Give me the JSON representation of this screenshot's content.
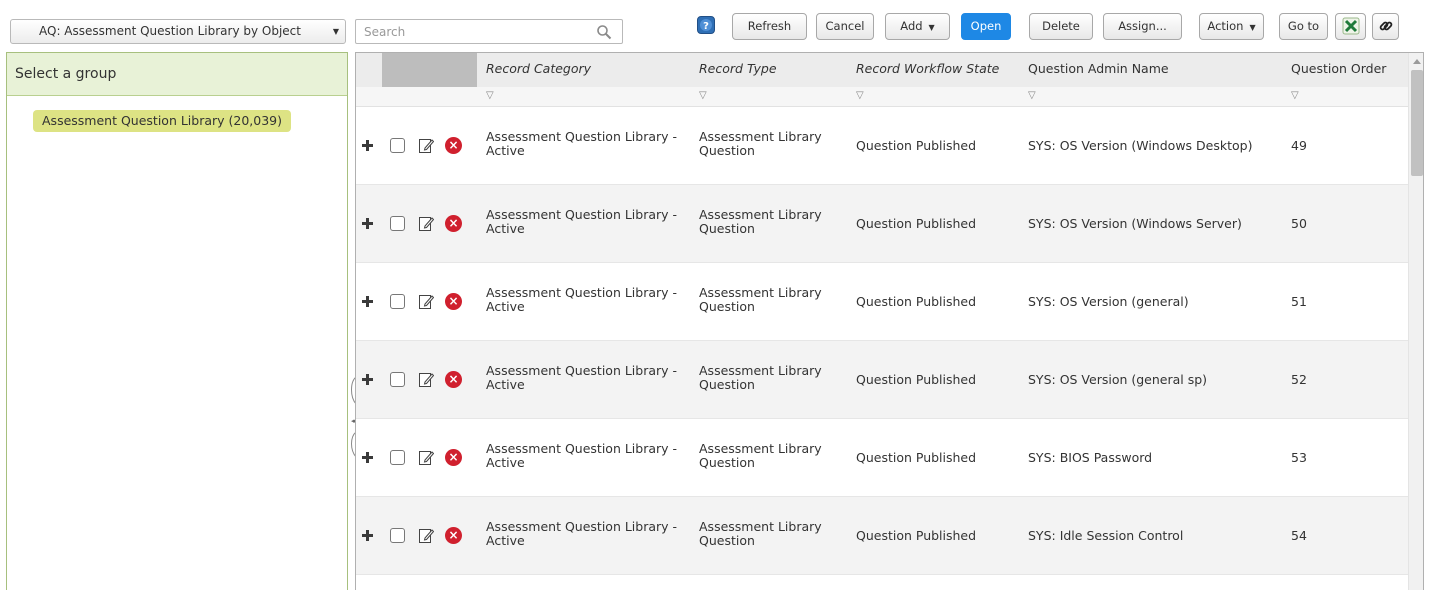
{
  "toolbar": {
    "view_select": "AQ: Assessment Question Library by Object",
    "search_placeholder": "Search",
    "refresh": "Refresh",
    "cancel": "Cancel",
    "add": "Add",
    "open": "Open",
    "delete": "Delete",
    "assign": "Assign...",
    "action": "Action",
    "goto": "Go to"
  },
  "left_panel": {
    "header": "Select a group",
    "group": "Assessment Question Library (20,039)"
  },
  "grid": {
    "columns": [
      "Record Category",
      "Record Type",
      "Record Workflow State",
      "Question Admin Name",
      "Question Order"
    ],
    "rows": [
      {
        "category_1": "Assessment Question Library -",
        "category_2": "Active",
        "type_1": "Assessment Library",
        "type_2": "Question",
        "state": "Question Published",
        "name": "SYS: OS Version (Windows Desktop)",
        "order": "49"
      },
      {
        "category_1": "Assessment Question Library -",
        "category_2": "Active",
        "type_1": "Assessment Library",
        "type_2": "Question",
        "state": "Question Published",
        "name": "SYS: OS Version (Windows Server)",
        "order": "50"
      },
      {
        "category_1": "Assessment Question Library -",
        "category_2": "Active",
        "type_1": "Assessment Library",
        "type_2": "Question",
        "state": "Question Published",
        "name": "SYS: OS Version (general)",
        "order": "51"
      },
      {
        "category_1": "Assessment Question Library -",
        "category_2": "Active",
        "type_1": "Assessment Library",
        "type_2": "Question",
        "state": "Question Published",
        "name": "SYS: OS Version (general sp)",
        "order": "52"
      },
      {
        "category_1": "Assessment Question Library -",
        "category_2": "Active",
        "type_1": "Assessment Library",
        "type_2": "Question",
        "state": "Question Published",
        "name": "SYS: BIOS Password",
        "order": "53"
      },
      {
        "category_1": "Assessment Question Library -",
        "category_2": "Active",
        "type_1": "Assessment Library",
        "type_2": "Question",
        "state": "Question Published",
        "name": "SYS: Idle Session Control",
        "order": "54"
      }
    ]
  },
  "icons": {
    "help": "help-icon",
    "excel": "excel-icon",
    "link": "link-icon",
    "search": "search-icon",
    "expand": "plus-icon",
    "edit": "edit-icon",
    "delete": "delete-icon",
    "filter": "filter-icon"
  },
  "colors": {
    "primary": "#1e88e5",
    "group_header_bg": "#e8f2d7",
    "group_chip_bg": "#dde384",
    "delete_red": "#d0202e",
    "excel_green": "#1f7a3a"
  }
}
